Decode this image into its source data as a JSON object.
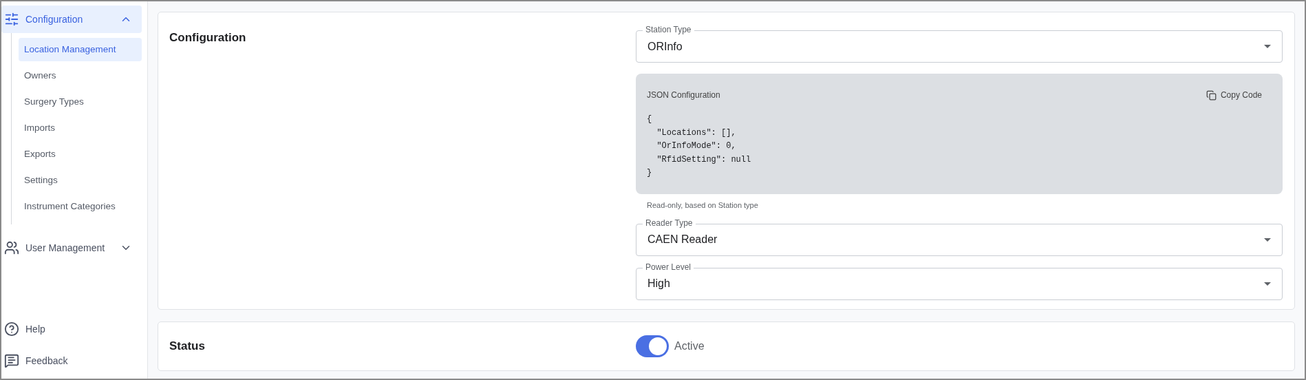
{
  "sidebar": {
    "groups": [
      {
        "label": "Configuration",
        "expanded": true,
        "selected": true,
        "items": [
          {
            "label": "Location Management",
            "selected": true
          },
          {
            "label": "Owners",
            "selected": false
          },
          {
            "label": "Surgery Types",
            "selected": false
          },
          {
            "label": "Imports",
            "selected": false
          },
          {
            "label": "Exports",
            "selected": false
          },
          {
            "label": "Settings",
            "selected": false
          },
          {
            "label": "Instrument Categories",
            "selected": false
          }
        ]
      },
      {
        "label": "User Management",
        "expanded": false,
        "selected": false
      }
    ],
    "footer": [
      {
        "label": "Help"
      },
      {
        "label": "Feedback"
      }
    ]
  },
  "configuration": {
    "title": "Configuration",
    "station_type": {
      "label": "Station Type",
      "value": "ORInfo"
    },
    "json_box": {
      "title": "JSON Configuration",
      "copy_button": "Copy Code",
      "code": [
        "{",
        "  \"Locations\": [],",
        "  \"OrInfoMode\": 0,",
        "  \"RfidSetting\": null",
        "}"
      ],
      "helper": "Read-only, based on Station type"
    },
    "reader_type": {
      "label": "Reader Type",
      "value": "CAEN Reader"
    },
    "power_level": {
      "label": "Power Level",
      "value": "High"
    }
  },
  "status": {
    "title": "Status",
    "toggle": {
      "label": "Active",
      "on": true
    }
  }
}
